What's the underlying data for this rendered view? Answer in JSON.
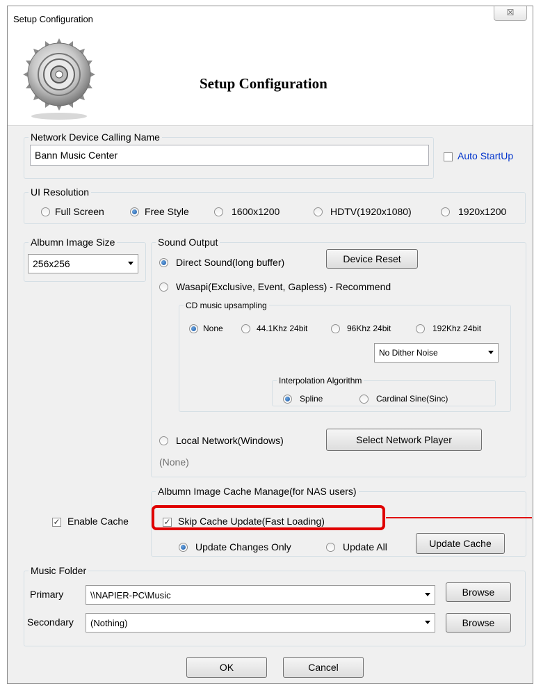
{
  "window": {
    "title": "Setup Configuration",
    "close_symbol": "☒"
  },
  "header": {
    "title": "Setup Configuration"
  },
  "network": {
    "group_label": "Network Device Calling Name",
    "name_value": "Bann Music Center",
    "auto_startup_label": "Auto StartUp",
    "auto_startup_checked": false
  },
  "resolution": {
    "group_label": "UI Resolution",
    "options": [
      "Full Screen",
      "Free Style",
      "1600x1200",
      "HDTV(1920x1080)",
      "1920x1200"
    ],
    "selected": "Free Style"
  },
  "album_image_size": {
    "group_label": "Albumn Image Size",
    "value": "256x256"
  },
  "sound_output": {
    "group_label": "Sound Output",
    "direct_sound_label": "Direct Sound(long buffer)",
    "device_reset_label": "Device Reset",
    "wasapi_label": "Wasapi(Exclusive, Event, Gapless) - Recommend",
    "cd_upsampling": {
      "group_label": "CD music upsampling",
      "options": [
        "None",
        "44.1Khz 24bit",
        "96Khz 24bit",
        "192Khz 24bit"
      ],
      "selected": "None"
    },
    "dither_value": "No Dither Noise",
    "interpolation": {
      "group_label": "Interpolation Algorithm",
      "options": [
        "Spline",
        "Cardinal Sine(Sinc)"
      ],
      "selected": "Spline"
    },
    "local_network_label": "Local Network(Windows)",
    "select_player_label": "Select Network Player",
    "none_status": "(None)"
  },
  "cache": {
    "enable_cache_label": "Enable Cache",
    "group_label": "Albumn Image Cache Manage(for NAS users)",
    "skip_update_label": "Skip Cache Update(Fast Loading)",
    "update_changes_label": "Update Changes Only",
    "update_all_label": "Update All",
    "update_cache_button": "Update Cache",
    "highlight_color": "#e00000"
  },
  "music_folder": {
    "group_label": "Music Folder",
    "primary_label": "Primary",
    "primary_value": "\\\\NAPIER-PC\\Music",
    "secondary_label": "Secondary",
    "secondary_value": "(Nothing)",
    "browse_label": "Browse"
  },
  "footer": {
    "ok_label": "OK",
    "cancel_label": "Cancel"
  }
}
